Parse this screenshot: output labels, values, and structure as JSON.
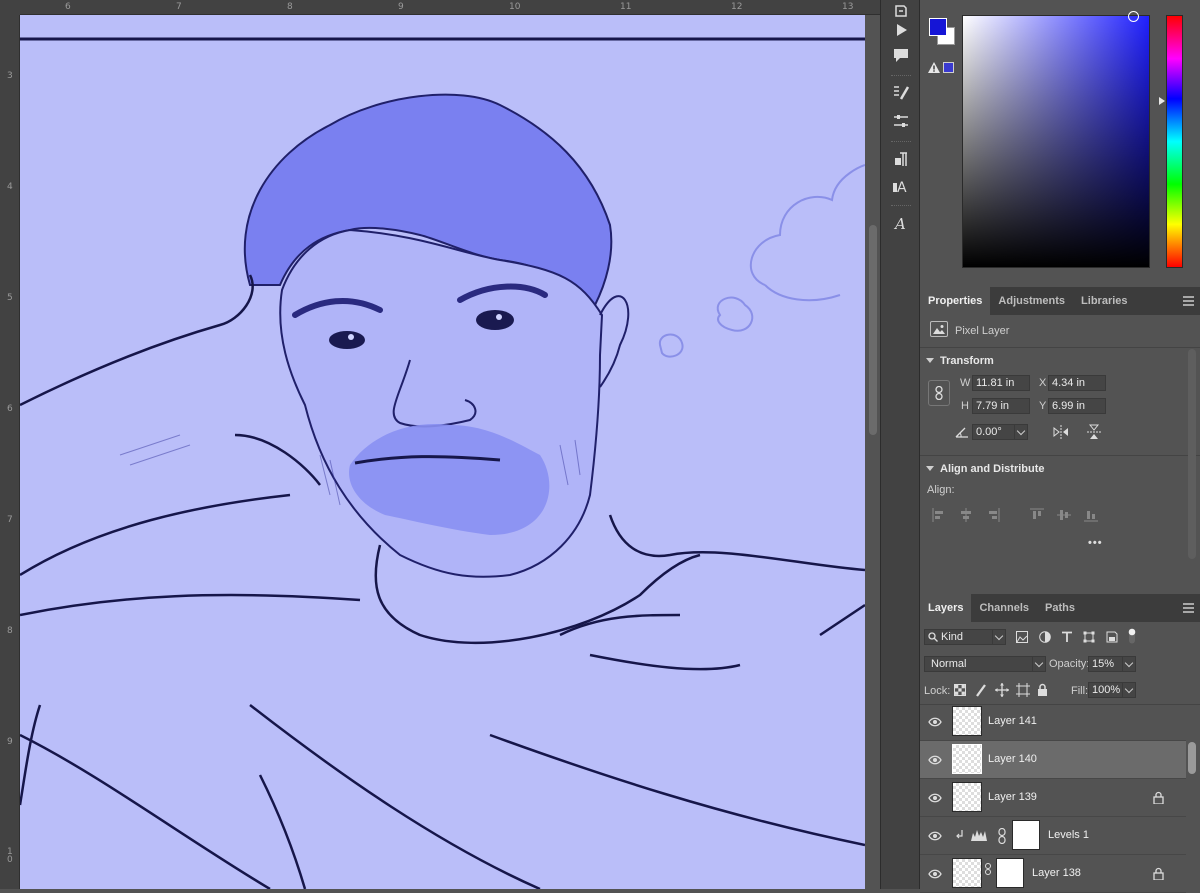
{
  "rulers": {
    "top_ticks": [
      "6",
      "7",
      "8",
      "9",
      "10",
      "11",
      "12",
      "13"
    ],
    "left_ticks": [
      "3",
      "4",
      "5",
      "6",
      "7",
      "8",
      "9",
      "10"
    ]
  },
  "colors": {
    "foreground": "#1515d6",
    "background": "#ffffff",
    "canvas": "#babef9"
  },
  "tools": [
    "history-icon",
    "play-icon",
    "comment-icon",
    "brush-presets-icon",
    "sliders-icon",
    "paragraph-icon",
    "character-icon",
    "glyphs-icon"
  ],
  "properties": {
    "tabs": [
      "Properties",
      "Adjustments",
      "Libraries"
    ],
    "layer_type": "Pixel Layer",
    "transform": {
      "heading": "Transform",
      "w_label": "W",
      "w_value": "11.81 in",
      "h_label": "H",
      "h_value": "7.79 in",
      "x_label": "X",
      "x_value": "4.34 in",
      "y_label": "Y",
      "y_value": "6.99 in",
      "angle_value": "0.00°"
    },
    "align": {
      "heading": "Align and Distribute",
      "label": "Align:",
      "more": "•••"
    }
  },
  "layers": {
    "tabs": [
      "Layers",
      "Channels",
      "Paths"
    ],
    "filter_kind": "Kind",
    "blend_mode": "Normal",
    "opacity_label": "Opacity:",
    "opacity_value": "15%",
    "lock_label": "Lock:",
    "fill_label": "Fill:",
    "fill_value": "100%",
    "rows": [
      {
        "name": "Layer 141",
        "locked": false,
        "selected": false
      },
      {
        "name": "Layer 140",
        "locked": false,
        "selected": true
      },
      {
        "name": "Layer 139",
        "locked": true,
        "selected": false
      },
      {
        "name": "Levels 1",
        "locked": false,
        "selected": false
      },
      {
        "name": "Layer 138",
        "locked": true,
        "selected": false
      }
    ]
  }
}
